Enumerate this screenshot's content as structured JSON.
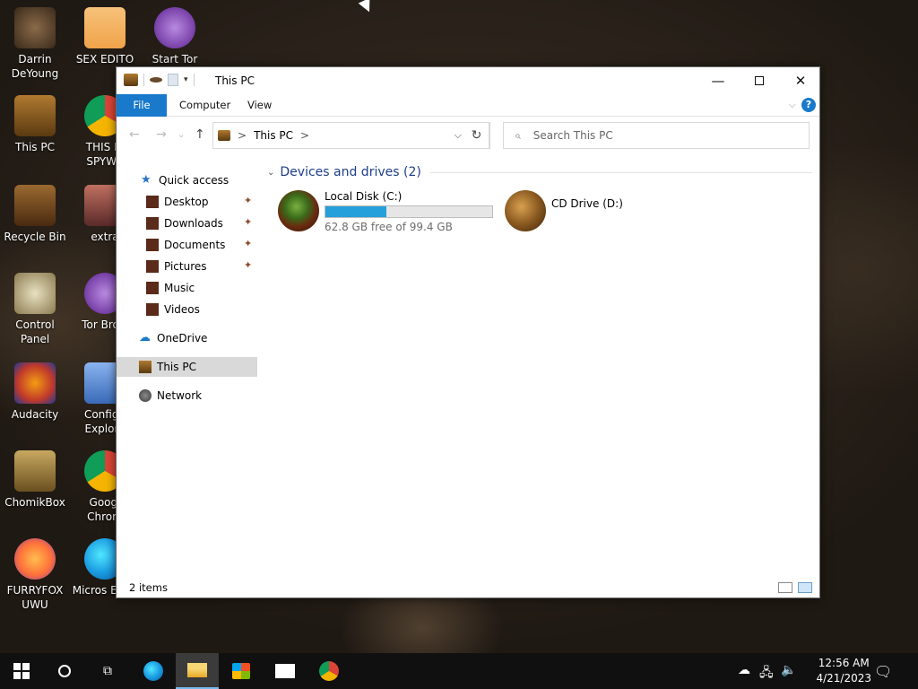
{
  "desktop": {
    "icons": [
      {
        "label": "Darrin DeYoung",
        "icon": "user-folder-icon",
        "color": "#7a4a2a"
      },
      {
        "label": "SEX EDITO",
        "icon": "hex-editor-icon",
        "color": "#f1a34a"
      },
      {
        "label": "Start Tor",
        "icon": "tor-icon",
        "color": "#7d3cb4"
      },
      {
        "label": "This PC",
        "icon": "computer-icon",
        "color": "#8a5a20"
      },
      {
        "label": "THIS IS SPYWA",
        "icon": "chrome-icon",
        "color": "#db4437"
      },
      {
        "label": "Recycle Bin",
        "icon": "recycle-bin-icon",
        "color": "#6b4a2a"
      },
      {
        "label": "extra",
        "icon": "app-icon",
        "color": "#7a4a3a"
      },
      {
        "label": "Control Panel",
        "icon": "control-panel-icon",
        "color": "#b0a070"
      },
      {
        "label": "Tor Brow",
        "icon": "tor-browser-icon",
        "color": "#7d3cb4"
      },
      {
        "label": "Audacity",
        "icon": "audacity-icon",
        "color": "#f39c12"
      },
      {
        "label": "Configu Explore",
        "icon": "shield-icon",
        "color": "#5a8ad8"
      },
      {
        "label": "ChomikBox",
        "icon": "chomikbox-icon",
        "color": "#a58a40"
      },
      {
        "label": "Googl Chrom",
        "icon": "chrome-icon",
        "color": "#34a853"
      },
      {
        "label": "FURRYFOX UWU",
        "icon": "firefox-icon",
        "color": "#ff7139"
      },
      {
        "label": "Micros Edge",
        "icon": "edge-icon",
        "color": "#1b9de2"
      }
    ]
  },
  "window": {
    "title": "This PC",
    "ribbon_tabs": [
      "File",
      "Computer",
      "View"
    ],
    "address": {
      "location": "This PC",
      "separator": ">"
    },
    "search_placeholder": "Search This PC",
    "nav": {
      "quick_access": "Quick access",
      "pinned": [
        "Desktop",
        "Downloads",
        "Documents",
        "Pictures"
      ],
      "unpinned": [
        "Music",
        "Videos"
      ],
      "onedrive": "OneDrive",
      "this_pc": "This PC",
      "network": "Network"
    },
    "group_header": "Devices and drives (2)",
    "drives": [
      {
        "name": "Local Disk (C:)",
        "free_text": "62.8 GB free of 99.4 GB",
        "used_fraction": 0.368
      },
      {
        "name": "CD Drive (D:)"
      }
    ],
    "status": "2 items"
  },
  "taskbar": {
    "clock_time": "12:56 AM",
    "clock_date": "4/21/2023"
  },
  "colors": {
    "accent": "#1979ca",
    "drive_bar": "#26a0da",
    "group_header": "#1e3e8a",
    "selection": "#d9d9d9"
  }
}
